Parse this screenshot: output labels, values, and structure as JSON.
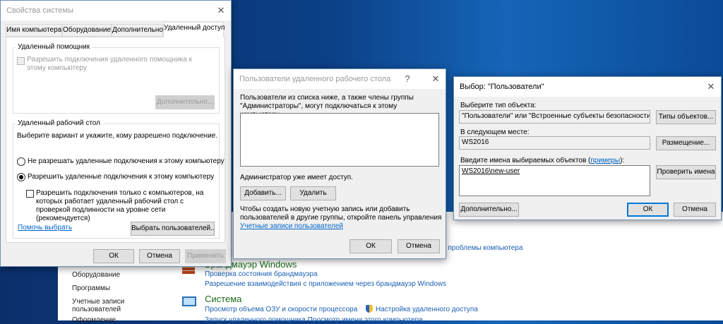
{
  "control_panel": {
    "heading_firewall": "Брандмауэр Windows",
    "heading_system": "Система",
    "link_troubleshoot": "е проблемы компьютера",
    "link_firewall_status": "Проверка состояния брандмауэра",
    "link_firewall_apps": "Разрешение взаимодействия с приложением через брандмауэр Windows",
    "link_ram_cpu": "Просмотр объема ОЗУ и скорости процессора",
    "link_remote_access": "Настройка удаленного доступа",
    "link_partial_bottom": "Запуск удаленного помощника    Просмотр имени этого компьютера",
    "nav_items": [
      "Оборудование",
      "Программы",
      "Учетные записи",
      "пользователей",
      "Оформление"
    ]
  },
  "sys_props": {
    "title": "Свойства системы",
    "close": "✕",
    "tabs": [
      "Имя компьютера",
      "Оборудование",
      "Дополнительно",
      "Удаленный доступ"
    ],
    "assistance_group": "Удаленный помощник",
    "assistance_checkbox": "Разрешить подключения удаленного помощника к этому компьютеру",
    "advanced_button": "Дополнительно...",
    "desktop_group": "Удаленный рабочий стол",
    "desktop_prompt": "Выберите вариант и укажите, кому разрешено подключение.",
    "radio_deny": "Не разрешать удаленные подключения к этому компьютеру",
    "radio_allow": "Разрешить удаленные подключения к этому компьютеру",
    "nla_checkbox": "Разрешить подключения только с компьютеров, на которых работает удаленный рабочий стол с проверкой подлинности на уровне сети (рекомендуется)",
    "help_link": "Помочь выбрать",
    "select_users_button": "Выбрать пользователей...",
    "ok": "ОК",
    "cancel": "Отмена",
    "apply": "Применить"
  },
  "rdu": {
    "title": "Пользователи удаленного рабочего стола",
    "help": "?",
    "close": "✕",
    "info": "Пользователи из списка ниже, а также члены группы \"Администраторы\", могут подключаться к этому компьютеру.",
    "admin_note": "Администратор уже имеет доступ.",
    "add_button": "Добавить...",
    "remove_button": "Удалить",
    "create_text": "Чтобы создать новую учетную запись или добавить пользователей в другие группы, откройте панель управления ",
    "create_link": "Учетные записи пользователей",
    "ok": "ОК",
    "cancel": "Отмена"
  },
  "select_users": {
    "title": "Выбор: \"Пользователи\"",
    "close": "✕",
    "object_type_label": "Выберите тип объекта:",
    "object_type_value": "\"Пользователи\" или \"Встроенные субъекты безопасности\"",
    "object_types_button": "Типы объектов...",
    "location_label": "В следующем месте:",
    "location_value": "WS2016",
    "locations_button": "Размещение...",
    "names_label": "Введите имена выбираемых объектов (",
    "names_label_link": "примеры",
    "names_label_end": "):",
    "names_value": "WS2016\\new-user",
    "check_names_button": "Проверить имена",
    "advanced_button": "Дополнительно...",
    "ok": "ОК",
    "cancel": "Отмена"
  }
}
